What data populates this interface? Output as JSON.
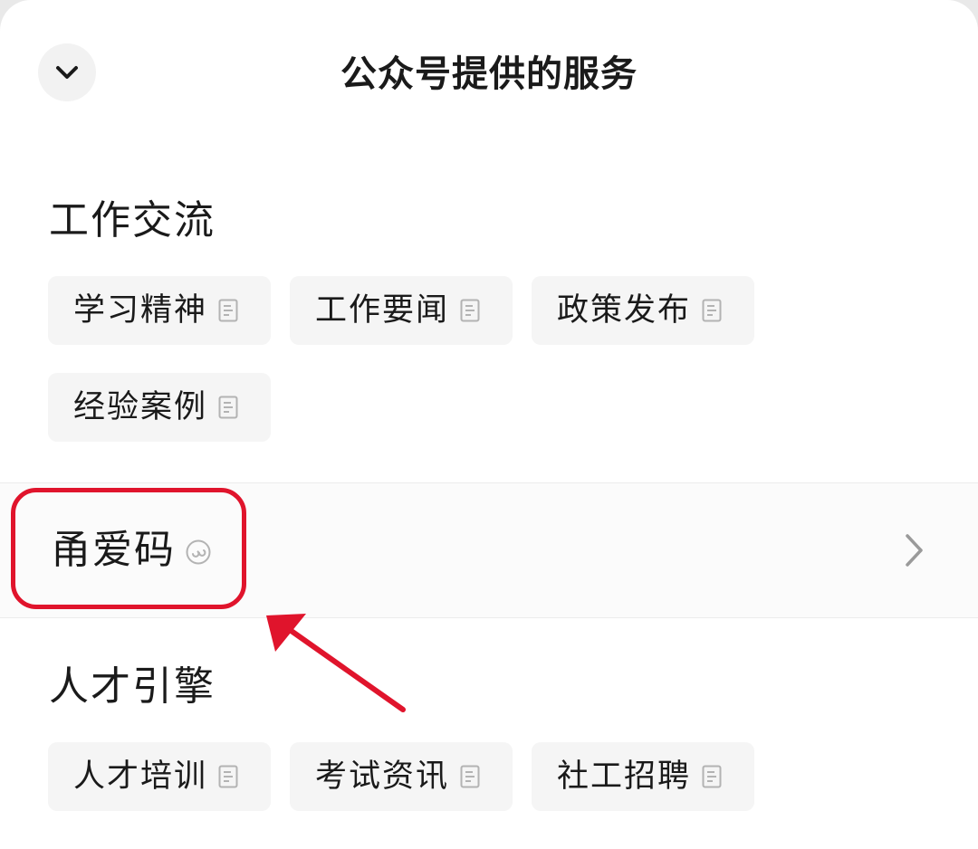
{
  "header": {
    "title": "公众号提供的服务"
  },
  "sections": [
    {
      "title": "工作交流",
      "chips": [
        "学习精神",
        "工作要闻",
        "政策发布",
        "经验案例"
      ]
    },
    {
      "title": "人才引擎",
      "chips": [
        "人才培训",
        "考试资讯",
        "社工招聘"
      ]
    }
  ],
  "mini_program": {
    "label": "甬爱码"
  },
  "colors": {
    "annotation": "#e0142c",
    "chip_bg": "#f5f5f5",
    "icon_gray": "#b3b3b3"
  },
  "icons": {
    "collapse": "chevron-down-icon",
    "chip": "article-doc-icon",
    "mini_program": "mini-program-icon",
    "row_arrow": "chevron-right-icon"
  }
}
